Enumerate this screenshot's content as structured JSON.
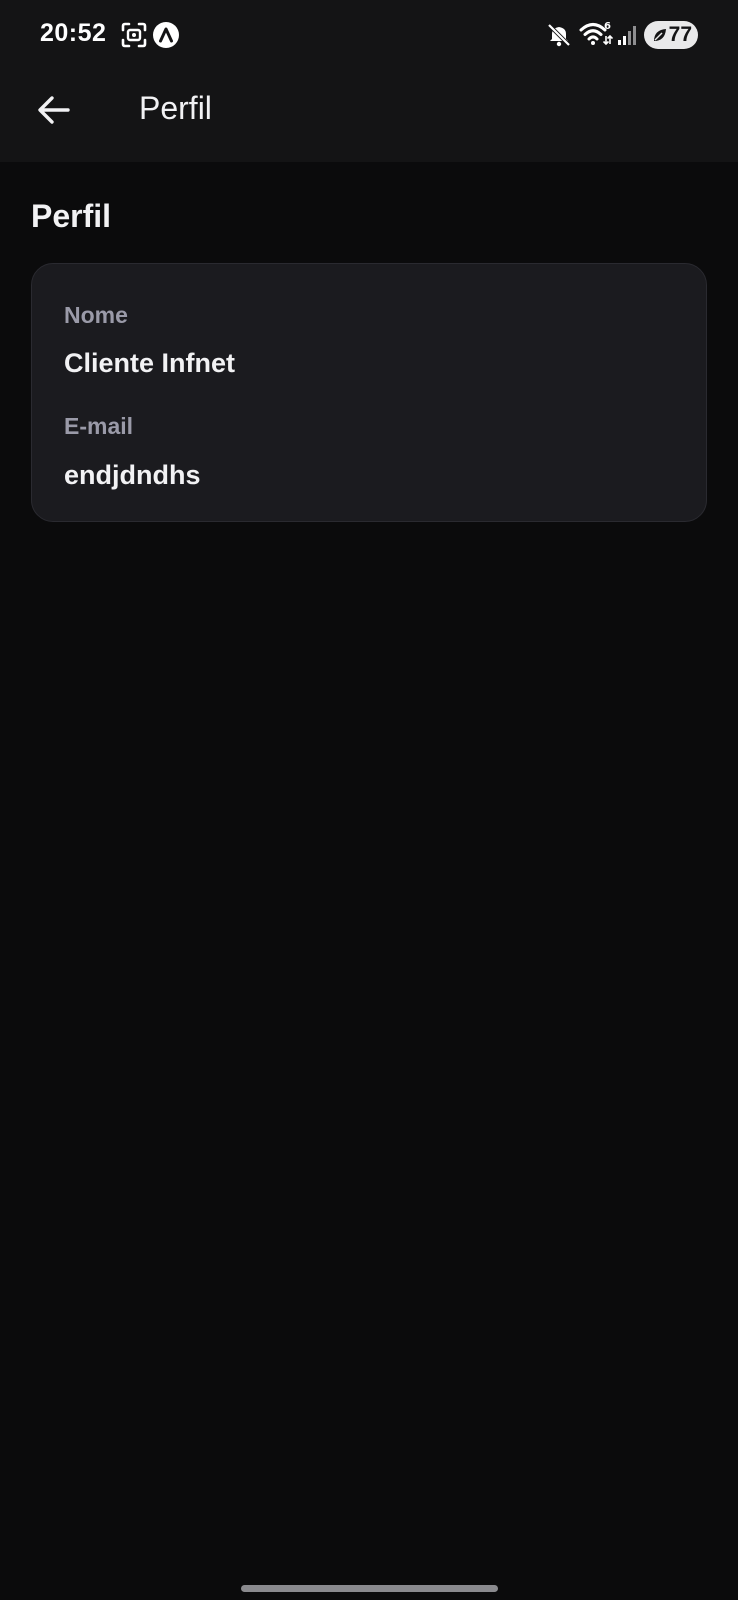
{
  "status_bar": {
    "time": "20:52",
    "battery": "77",
    "icons": [
      "screenshot-icon",
      "app-notification-icon",
      "mute-icon",
      "wifi-icon",
      "signal-icon",
      "battery-icon"
    ]
  },
  "app_bar": {
    "title": "Perfil",
    "back_icon": "arrow-left-icon"
  },
  "page": {
    "section_title": "Perfil"
  },
  "profile": {
    "name_label": "Nome",
    "name_value": "Cliente Infnet",
    "email_label": "E-mail",
    "email_value": "endjdndhs"
  },
  "colors": {
    "background": "#0b0b0c",
    "top_surface": "#141415",
    "card": "#1b1b1f",
    "label": "#9a9aa8",
    "text": "#f2f2f4"
  }
}
